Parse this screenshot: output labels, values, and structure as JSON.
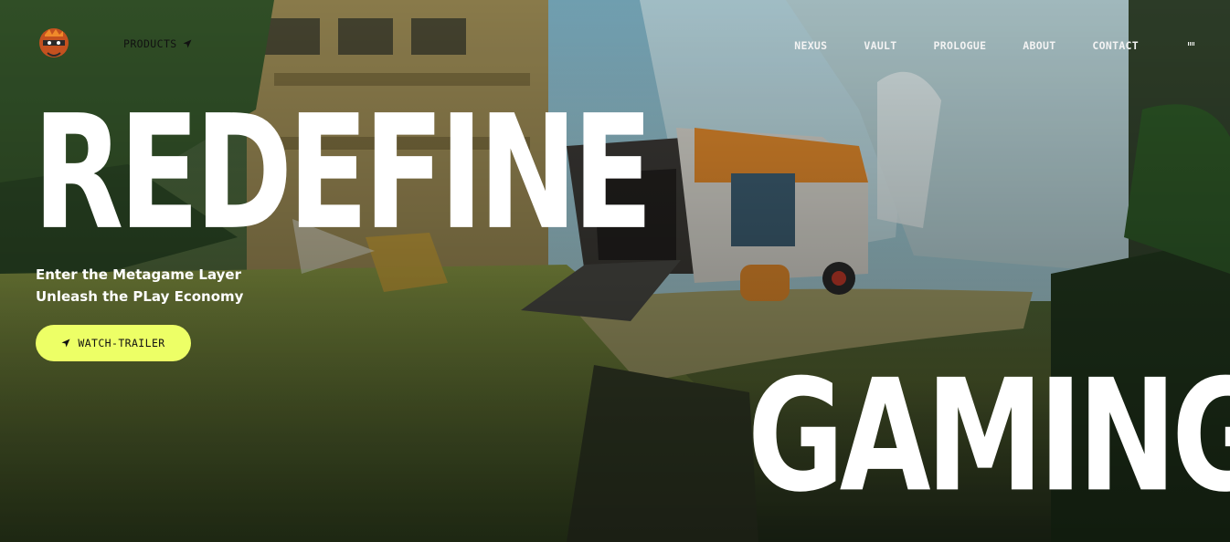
{
  "nav": {
    "products_label": "PRODUCTS",
    "links": [
      "NEXUS",
      "VAULT",
      "PROLOGUE",
      "ABOUT",
      "CONTACT"
    ],
    "logo_icon": "ninja-mascot-icon",
    "audio_icon": "audio-indicator-icon"
  },
  "hero": {
    "headline_top": "REDEFINE",
    "headline_bottom": "GAMING",
    "tagline_line1": "Enter the Metagame Layer",
    "tagline_line2": "Unleash the PLay Economy",
    "cta_label": "WATCH-TRAILER",
    "cta_icon": "location-arrow-icon"
  },
  "colors": {
    "accent": "#edff66",
    "headline": "#ffffff"
  }
}
